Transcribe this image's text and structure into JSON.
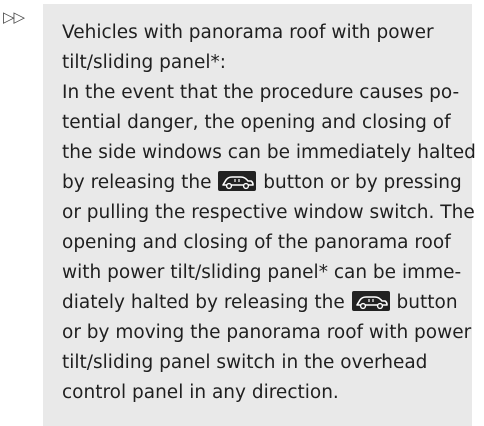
{
  "marker": "▷▷",
  "note": {
    "lines": [
      "Vehicles with panorama roof with power",
      "tilt/sliding panel*:",
      "In the event that the procedure causes po-",
      "tential danger, the opening and closing of",
      "the side windows can be immediately halted",
      [
        "by releasing the ",
        " button or by pressing"
      ],
      "or pulling the respective window switch. The",
      "opening and closing of the panorama roof",
      "with power tilt/sliding panel* can be imme-",
      [
        "diately halted by releasing the ",
        " button"
      ],
      "or by moving the panorama roof with power",
      "tilt/sliding panel switch in the overhead",
      "control panel in any direction."
    ],
    "icon": "convenience-closing-key-icon"
  }
}
